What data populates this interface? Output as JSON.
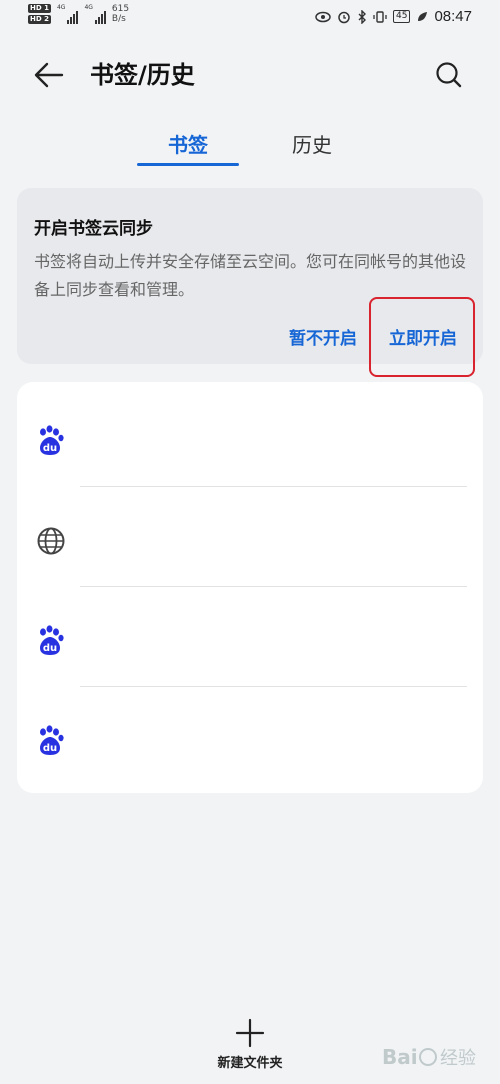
{
  "status_bar": {
    "sim1_label": "HD 1",
    "sim2_label": "HD 2",
    "network_1": "4G",
    "network_2": "4G",
    "speed_value": "615",
    "speed_unit": "B/s",
    "battery": "45",
    "time": "08:47"
  },
  "header": {
    "title": "书签/历史",
    "back_icon": "arrow-left-icon",
    "search_icon": "search-icon"
  },
  "tabs": [
    {
      "label": "书签",
      "active": true
    },
    {
      "label": "历史",
      "active": false
    }
  ],
  "sync_card": {
    "title": "开启书签云同步",
    "description": "书签将自动上传并安全存储至云空间。您可在同帐号的其他设备上同步查看和管理。",
    "later_label": "暂不开启",
    "enable_label": "立即开启"
  },
  "bookmarks": [
    {
      "icon": "baidu-paw-icon"
    },
    {
      "icon": "globe-icon"
    },
    {
      "icon": "baidu-paw-icon"
    },
    {
      "icon": "baidu-paw-icon"
    }
  ],
  "footer": {
    "new_folder_label": "新建文件夹",
    "new_folder_icon": "plus-icon"
  },
  "watermark": {
    "text": "Bai 经验"
  },
  "colors": {
    "accent": "#1766d6",
    "highlight": "#d9232e",
    "background": "#f1f3f5",
    "baidu_blue": "#2932e1"
  }
}
